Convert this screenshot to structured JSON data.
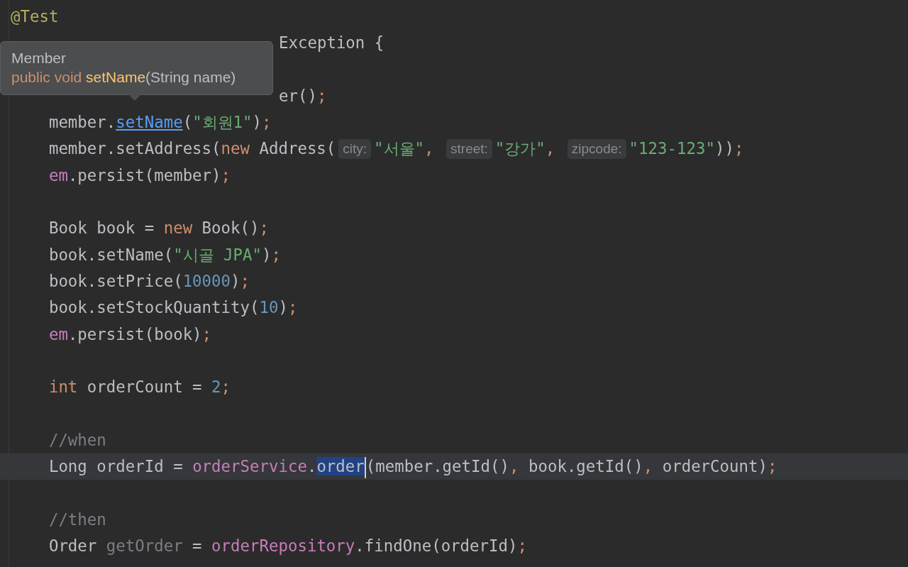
{
  "tooltip": {
    "class_name": "Member",
    "signature": [
      {
        "text": "public void ",
        "kind": "keyword"
      },
      {
        "text": "setName",
        "kind": "method"
      },
      {
        "text": "(String name)",
        "kind": "plain"
      }
    ]
  },
  "lines": [
    {
      "current": false,
      "covered": false,
      "tokens": [
        {
          "text": "@Test",
          "kind": "annotation"
        }
      ]
    },
    {
      "current": false,
      "covered": true,
      "tokens": [
        {
          "text": "Exception {",
          "kind": "plain"
        }
      ],
      "children": [
        {
          "current": false
        },
        {
          "current": false,
          "covered": true,
          "tokens": [
            {
              "text": "er()",
              "kind": "plain"
            },
            {
              "text": ";",
              "kind": "keyword"
            }
          ]
        },
        {
          "current": false,
          "covered": false,
          "tokens": [
            {
              "text": "member.",
              "kind": "plain"
            },
            {
              "text": "setName",
              "kind": "link"
            },
            {
              "text": "(",
              "kind": "plain"
            },
            {
              "text": "\"회원1\"",
              "kind": "string"
            },
            {
              "text": ")",
              "kind": "plain"
            },
            {
              "text": ";",
              "kind": "keyword"
            }
          ]
        },
        {
          "current": false,
          "covered": false,
          "tokens": [
            {
              "text": "member.setAddress(",
              "kind": "plain"
            },
            {
              "text": "new ",
              "kind": "keyword"
            },
            {
              "text": "Address(",
              "kind": "plain"
            },
            {
              "text": "city:",
              "kind": "hint"
            },
            {
              "text": "\"서울\"",
              "kind": "string"
            },
            {
              "text": ", ",
              "kind": "keyword"
            },
            {
              "text": "street:",
              "kind": "hint"
            },
            {
              "text": "\"강가\"",
              "kind": "string"
            },
            {
              "text": ", ",
              "kind": "keyword"
            },
            {
              "text": "zipcode:",
              "kind": "hint"
            },
            {
              "text": "\"123-123\"",
              "kind": "string"
            },
            {
              "text": "))",
              "kind": "plain"
            },
            {
              "text": ";",
              "kind": "keyword"
            }
          ]
        },
        {
          "current": false,
          "covered": false,
          "tokens": [
            {
              "text": "em",
              "kind": "field"
            },
            {
              "text": ".persist(member)",
              "kind": "plain"
            },
            {
              "text": ";",
              "kind": "keyword"
            }
          ]
        },
        {
          "current": false
        },
        {
          "current": false,
          "covered": false,
          "tokens": [
            {
              "text": "Book book = ",
              "kind": "plain"
            },
            {
              "text": "new ",
              "kind": "keyword"
            },
            {
              "text": "Book()",
              "kind": "plain"
            },
            {
              "text": ";",
              "kind": "keyword"
            }
          ]
        },
        {
          "current": false,
          "covered": false,
          "tokens": [
            {
              "text": "book.setName(",
              "kind": "plain"
            },
            {
              "text": "\"시골 JPA\"",
              "kind": "string"
            },
            {
              "text": ")",
              "kind": "plain"
            },
            {
              "text": ";",
              "kind": "keyword"
            }
          ]
        },
        {
          "current": false,
          "covered": false,
          "tokens": [
            {
              "text": "book.setPrice(",
              "kind": "plain"
            },
            {
              "text": "10000",
              "kind": "number"
            },
            {
              "text": ")",
              "kind": "plain"
            },
            {
              "text": ";",
              "kind": "keyword"
            }
          ]
        },
        {
          "current": false,
          "covered": false,
          "tokens": [
            {
              "text": "book.setStockQuantity(",
              "kind": "plain"
            },
            {
              "text": "10",
              "kind": "number"
            },
            {
              "text": ")",
              "kind": "plain"
            },
            {
              "text": ";",
              "kind": "keyword"
            }
          ]
        },
        {
          "current": false,
          "covered": false,
          "tokens": [
            {
              "text": "em",
              "kind": "field"
            },
            {
              "text": ".persist(book)",
              "kind": "plain"
            },
            {
              "text": ";",
              "kind": "keyword"
            }
          ]
        },
        {
          "current": false
        },
        {
          "current": false,
          "covered": false,
          "tokens": [
            {
              "text": "int ",
              "kind": "keyword"
            },
            {
              "text": "orderCount = ",
              "kind": "plain"
            },
            {
              "text": "2",
              "kind": "number"
            },
            {
              "text": ";",
              "kind": "keyword"
            }
          ]
        },
        {
          "current": false
        },
        {
          "current": false,
          "covered": false,
          "tokens": [
            {
              "text": "//when",
              "kind": "comment"
            }
          ]
        },
        {
          "current": true,
          "covered": false,
          "tokens": [
            {
              "text": "Long orderId = ",
              "kind": "plain"
            },
            {
              "text": "orderService",
              "kind": "field"
            },
            {
              "text": ".",
              "kind": "plain"
            },
            {
              "text": "order",
              "kind": "selection",
              "caret": true
            },
            {
              "text": "(member.getId()",
              "kind": "plain"
            },
            {
              "text": ", ",
              "kind": "keyword"
            },
            {
              "text": "book.getId()",
              "kind": "plain"
            },
            {
              "text": ", ",
              "kind": "keyword"
            },
            {
              "text": "orderCount)",
              "kind": "plain"
            },
            {
              "text": ";",
              "kind": "keyword"
            }
          ]
        },
        {
          "current": false
        },
        {
          "current": false,
          "covered": false,
          "tokens": [
            {
              "text": "//then",
              "kind": "comment"
            }
          ]
        },
        {
          "current": false,
          "covered": false,
          "tokens": [
            {
              "text": "Order ",
              "kind": "plain"
            },
            {
              "text": "getOrder",
              "kind": "unused"
            },
            {
              "text": " = ",
              "kind": "plain"
            },
            {
              "text": "orderRepository",
              "kind": "field"
            },
            {
              "text": ".findOne(orderId)",
              "kind": "plain"
            },
            {
              "text": ";",
              "kind": "keyword"
            }
          ]
        }
      ]
    }
  ]
}
